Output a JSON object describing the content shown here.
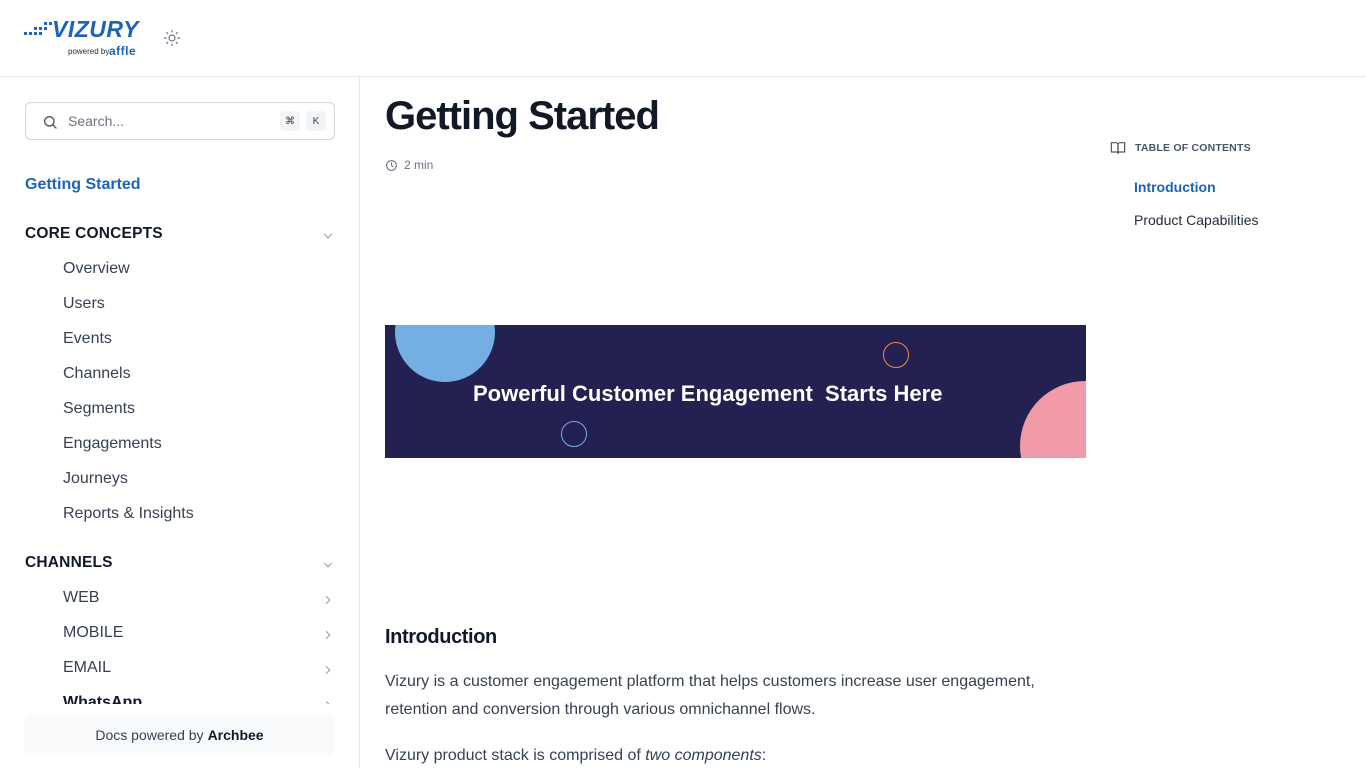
{
  "header": {
    "logo_text": "VIZURY",
    "logo_powered": "powered by",
    "logo_partner": "affle",
    "theme_toggle_icon": "sun-icon"
  },
  "sidebar": {
    "search": {
      "placeholder": "Search...",
      "shortcut_cmd": "⌘",
      "shortcut_key": "K"
    },
    "top_link": "Getting Started",
    "sections": [
      {
        "title": "CORE CONCEPTS",
        "expanded": true,
        "items": [
          "Overview",
          "Users",
          "Events",
          "Channels",
          "Segments",
          "Engagements",
          "Journeys",
          "Reports & Insights"
        ]
      },
      {
        "title": "CHANNELS",
        "expanded": true,
        "items": [
          "WEB",
          "MOBILE",
          "EMAIL",
          "WhatsApp"
        ]
      }
    ],
    "footer_prefix": "Docs powered by",
    "footer_brand": "Archbee"
  },
  "main": {
    "title": "Getting Started",
    "read_time": "2 min",
    "banner_text": "Powerful Customer Engagement  Starts Here",
    "banner_colors": {
      "background": "#232151",
      "accent_blue": "#74aee2",
      "accent_pink": "#f19aa8",
      "accent_orange": "#f08a3c"
    },
    "intro_heading": "Introduction",
    "intro_paragraph": "Vizury is a customer engagement platform that helps customers increase user engagement, retention and conversion through various omnichannel flows.",
    "stack_prefix": "Vizury product stack is comprised of ",
    "stack_emphasis": "two components",
    "stack_suffix": ":"
  },
  "toc": {
    "heading": "TABLE OF CONTENTS",
    "items": [
      {
        "label": "Introduction",
        "active": true
      },
      {
        "label": "Product Capabilities",
        "active": false
      }
    ]
  },
  "colors": {
    "accent": "#1d63b6",
    "text": "#1f2937",
    "muted": "#6b7280",
    "border": "#e5e7eb"
  }
}
